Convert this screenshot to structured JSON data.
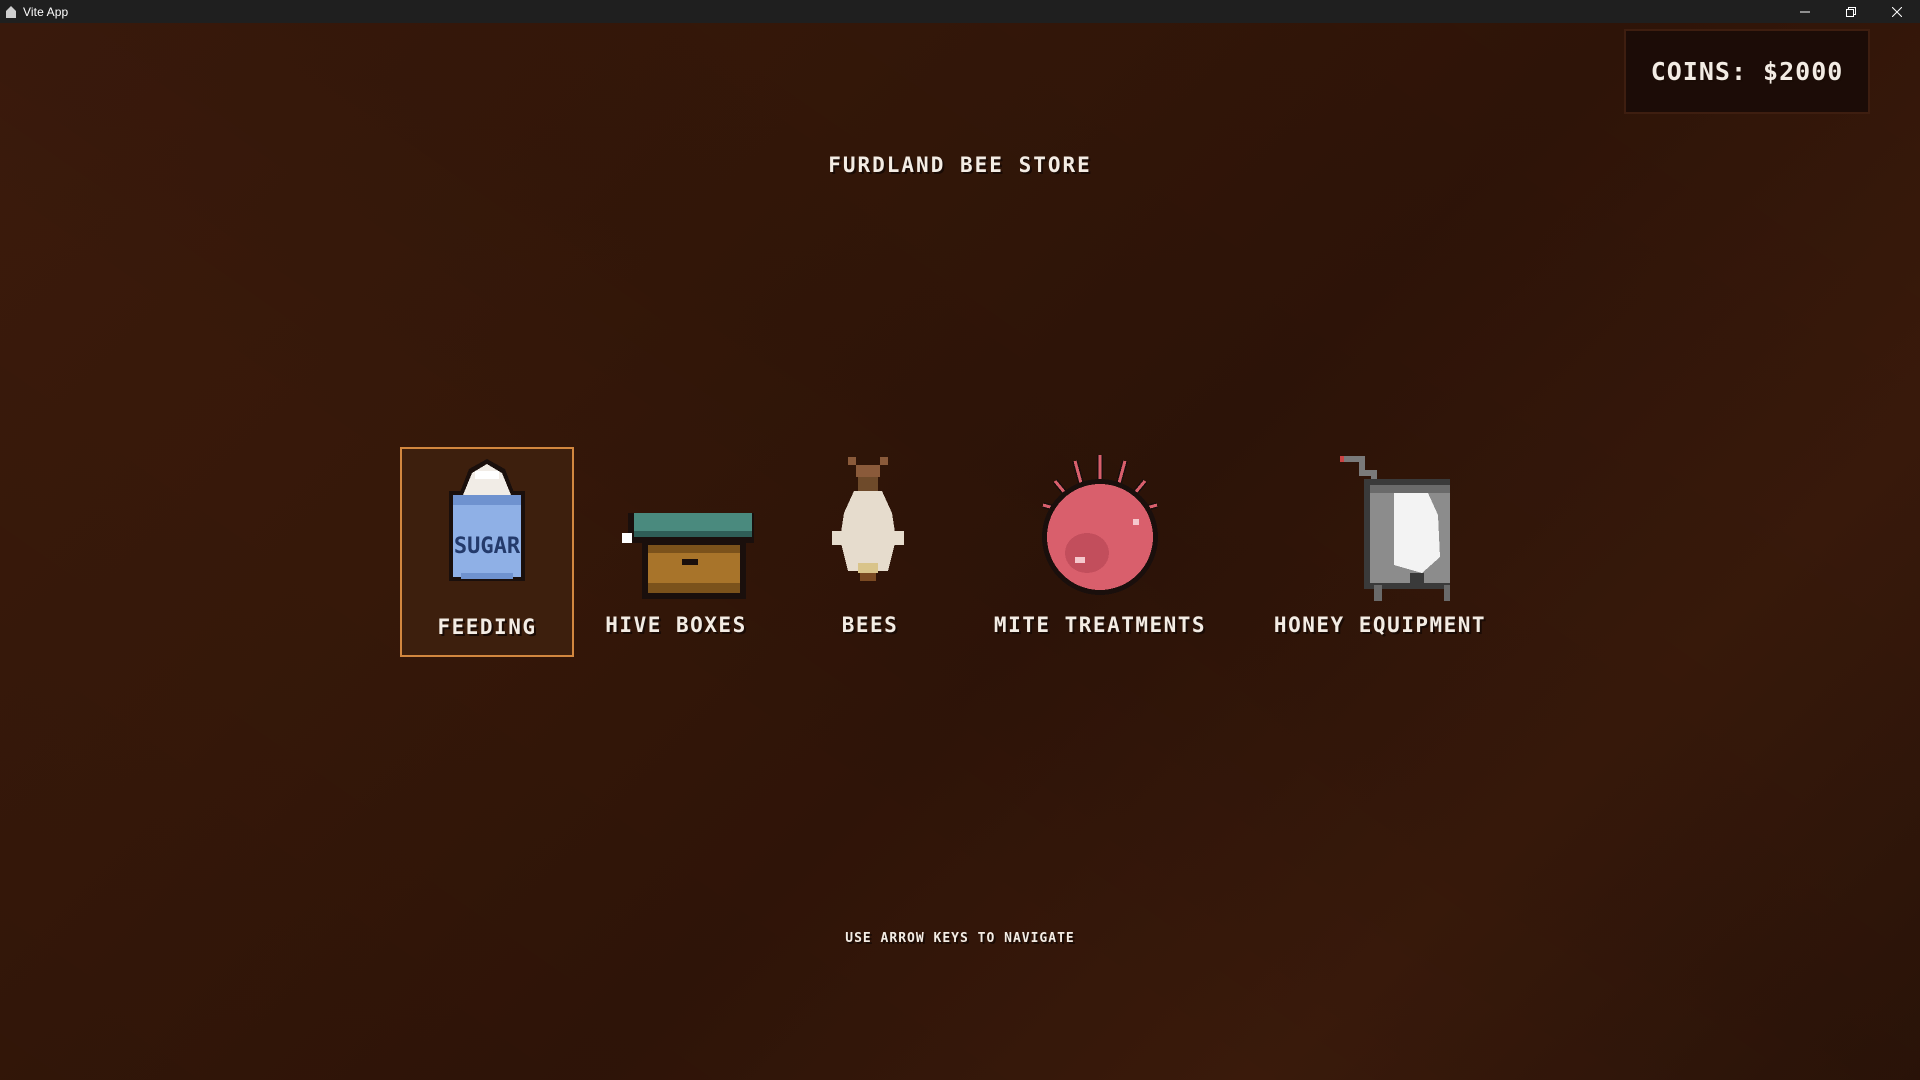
{
  "window": {
    "title": "Vite App"
  },
  "hud": {
    "coins_text": "COINS: $2000"
  },
  "store": {
    "title": "FURDLAND BEE STORE",
    "selected_index": 0,
    "categories": [
      {
        "label": "FEEDING",
        "icon": "sugar-bag-icon"
      },
      {
        "label": "HIVE BOXES",
        "icon": "hive-box-icon"
      },
      {
        "label": "BEES",
        "icon": "bee-package-icon"
      },
      {
        "label": "MITE TREATMENTS",
        "icon": "mite-treatment-icon"
      },
      {
        "label": "HONEY EQUIPMENT",
        "icon": "honey-extractor-icon"
      }
    ],
    "hint": "USE ARROW KEYS TO NAVIGATE"
  },
  "colors": {
    "background": "#361809",
    "selection_border": "#d2873f",
    "text": "#f3ece4",
    "coins_panel": "#1c0c07"
  }
}
